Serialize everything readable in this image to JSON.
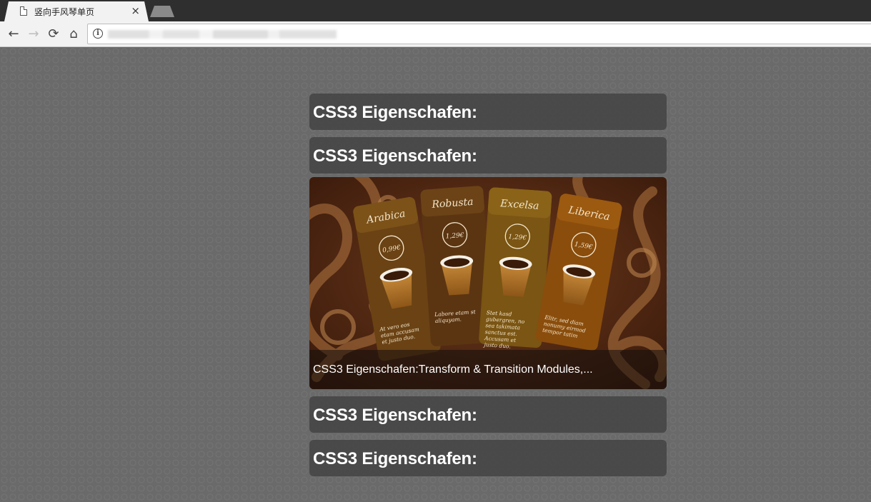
{
  "browser": {
    "tab_title": "竖向手风琴单页",
    "tab_close": "×"
  },
  "accordion": {
    "items": [
      {
        "title": "CSS3 Eigenschafen:"
      },
      {
        "title": "CSS3 Eigenschafen:"
      },
      {
        "caption": "CSS3 Eigenschafen:Transform & Transition Modules,..."
      },
      {
        "title": "CSS3 Eigenschafen:"
      },
      {
        "title": "CSS3 Eigenschafen:"
      }
    ]
  },
  "image": {
    "cards": [
      {
        "name": "Arabica",
        "price": "0,99€",
        "text": [
          "At vero eos",
          "etam accusam",
          "et justo duo."
        ]
      },
      {
        "name": "Robusta",
        "price": "1,29€",
        "text": [
          "Labore etam st",
          "aliquyam."
        ]
      },
      {
        "name": "Excelsa",
        "price": "1,29€",
        "text": [
          "Stet kasd",
          "gubergren, no",
          "sea takimata",
          "sanctus est.",
          "Accusam et",
          "justo duo."
        ]
      },
      {
        "name": "Liberica",
        "price": "1,59€",
        "text": [
          "Elitr, sed diam",
          "nonumy eirmod",
          "tempor tatim"
        ]
      }
    ]
  }
}
